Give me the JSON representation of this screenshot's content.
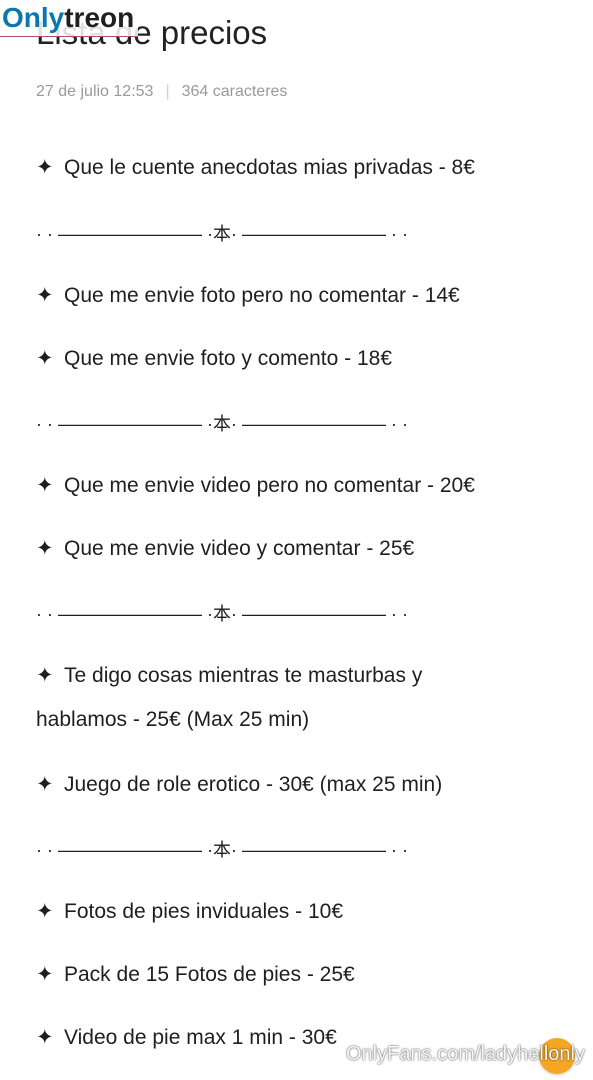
{
  "note": {
    "title": "Lista de precios",
    "date": "27 de julio 12:53",
    "char_count": "364 caracteres"
  },
  "items": [
    "Que le cuente anecdotas mias privadas - 8€",
    "Que me envie foto pero no comentar - 14€",
    "Que me envie foto y comento - 18€",
    "Que me envie video pero no comentar - 20€",
    "Que me envie video y comentar - 25€",
    "Te digo cosas mientras te masturbas y",
    "hablamos - 25€ (Max 25 min)",
    "Juego de role erotico - 30€ (max 25 min)",
    "Fotos de pies inviduales  - 10€",
    "Pack de 15 Fotos de pies - 25€",
    "Video de pie max 1 min - 30€"
  ],
  "bullet": "✦",
  "divider": "· · ———————— ·本· ———————— · ·",
  "watermarks": {
    "logo_part1": "Only",
    "logo_part2": "treon",
    "url": "OnlyFans.com/ladyhellonly"
  },
  "colors": {
    "logo_blue": "#0a78ad",
    "scroll_button": "#f5a623",
    "meta_gray": "#9a9a9a"
  },
  "icons": {
    "scroll_top": "arrow-up-icon"
  }
}
